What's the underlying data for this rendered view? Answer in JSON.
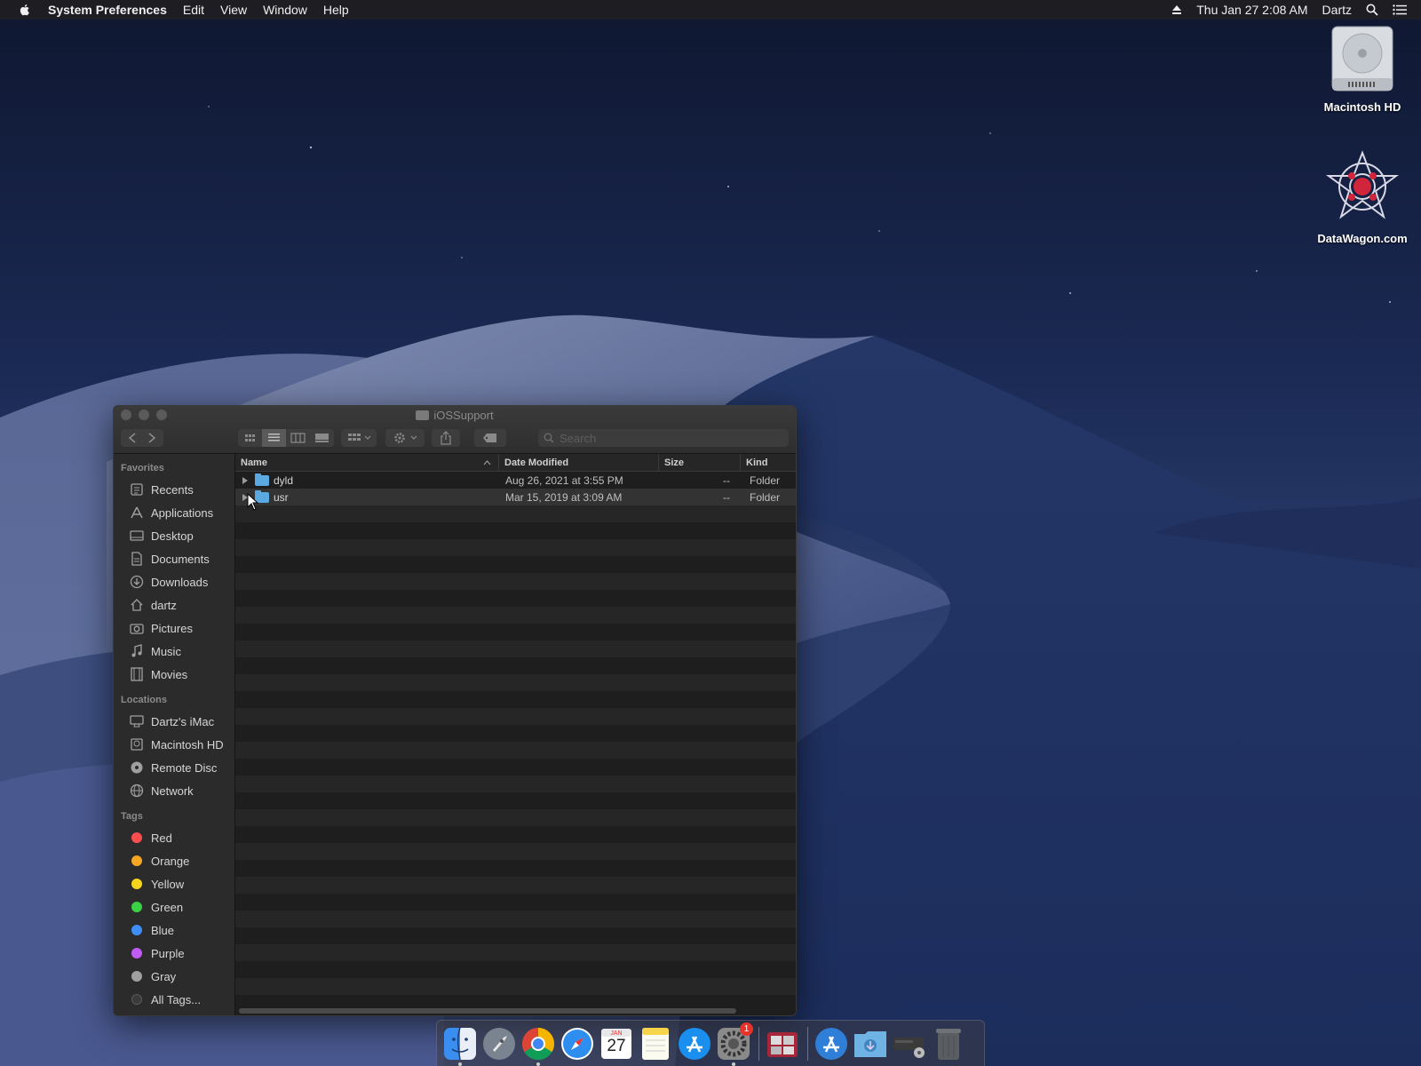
{
  "menubar": {
    "app_name": "System Preferences",
    "menus": [
      "Edit",
      "View",
      "Window",
      "Help"
    ],
    "datetime": "Thu Jan 27  2:08 AM",
    "user": "Dartz"
  },
  "desktop": {
    "icons": [
      {
        "label": "Macintosh HD",
        "icon": "hard-drive-icon"
      },
      {
        "label": "DataWagon.com",
        "icon": "datawagon-logo-icon"
      }
    ]
  },
  "finder": {
    "title": "iOSSupport",
    "search_placeholder": "Search",
    "columns": {
      "name": "Name",
      "date": "Date Modified",
      "size": "Size",
      "kind": "Kind"
    },
    "rows": [
      {
        "name": "dyld",
        "date": "Aug 26, 2021 at 3:55 PM",
        "size": "--",
        "kind": "Folder"
      },
      {
        "name": "usr",
        "date": "Mar 15, 2019 at 3:09 AM",
        "size": "--",
        "kind": "Folder"
      }
    ],
    "sidebar": {
      "favorites_heading": "Favorites",
      "favorites": [
        "Recents",
        "Applications",
        "Desktop",
        "Documents",
        "Downloads",
        "dartz",
        "Pictures",
        "Music",
        "Movies"
      ],
      "locations_heading": "Locations",
      "locations": [
        "Dartz's iMac",
        "Macintosh HD",
        "Remote Disc",
        "Network"
      ],
      "tags_heading": "Tags",
      "tags": [
        {
          "label": "Red",
          "color": "#ff4d4f"
        },
        {
          "label": "Orange",
          "color": "#f5a623"
        },
        {
          "label": "Yellow",
          "color": "#f8d51c"
        },
        {
          "label": "Green",
          "color": "#3bd145"
        },
        {
          "label": "Blue",
          "color": "#3f8ef7"
        },
        {
          "label": "Purple",
          "color": "#c05bf5"
        },
        {
          "label": "Gray",
          "color": "#a0a0a0"
        }
      ],
      "all_tags": "All Tags..."
    }
  },
  "dock": {
    "apps": [
      "Finder",
      "Launchpad",
      "Google Chrome",
      "Safari",
      "Calendar",
      "Notes",
      "App Store",
      "System Preferences",
      "Photo Booth",
      "App Store Installer",
      "Downloads Folder",
      "Disk Utility",
      "Trash"
    ],
    "calendar_day": "27",
    "calendar_month": "JAN",
    "system_prefs_badge": "1"
  }
}
